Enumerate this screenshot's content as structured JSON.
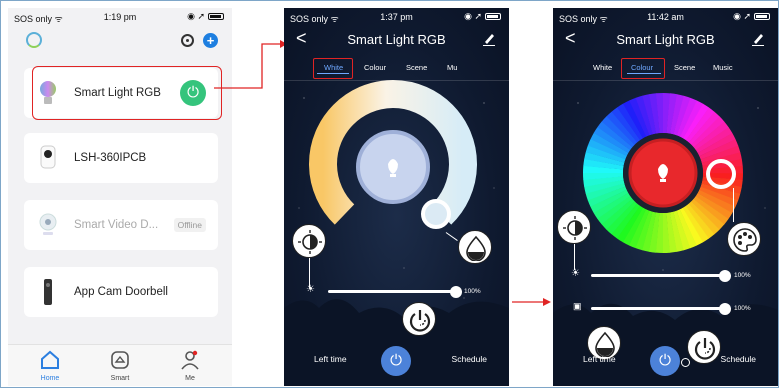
{
  "panel_home": {
    "status": {
      "carrier": "SOS only",
      "time": "1:19 pm",
      "indicators": "◉ ➚"
    },
    "devices": [
      {
        "name": "Smart Light RGB",
        "state": "on"
      },
      {
        "name": "LSH-360IPCB",
        "state": ""
      },
      {
        "name": "Smart Video D...",
        "state": "Offline"
      },
      {
        "name": "App Cam Doorbell",
        "state": ""
      }
    ],
    "tabs": [
      {
        "label": "Home"
      },
      {
        "label": "Smart"
      },
      {
        "label": "Me"
      }
    ]
  },
  "panel_white": {
    "status": {
      "carrier": "SOS only",
      "time": "1:37 pm",
      "indicators": "◉ ➚"
    },
    "title": "Smart Light RGB",
    "back": "<",
    "tabs": [
      "White",
      "Colour",
      "Scene",
      "Mu"
    ],
    "selected_tab": "White",
    "brightness_pct": "100%",
    "brightness_level": 1.0,
    "left_label": "Left time",
    "right_label": "Schedule"
  },
  "panel_colour": {
    "status": {
      "carrier": "SOS only",
      "time": "11:42 am",
      "indicators": "◉ ➚"
    },
    "title": "Smart Light RGB",
    "back": "<",
    "tabs": [
      "White",
      "Colour",
      "Scene",
      "Music"
    ],
    "selected_tab": "Colour",
    "brightness_pct": "100%",
    "saturation_pct": "100%",
    "brightness_level": 1.0,
    "saturation_level": 1.0,
    "left_label": "Left time",
    "right_label": "Schedule"
  },
  "colors": {
    "accent": "#2c7fe0",
    "power_on": "#34c47c",
    "highlight": "#e02424",
    "selected_colour": "#e8282c"
  }
}
